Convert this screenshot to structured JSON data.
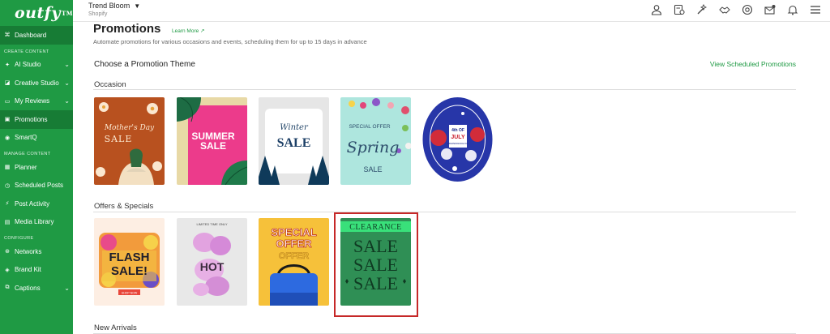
{
  "sidebar": {
    "logo": "outfy",
    "logo_tm": "TM",
    "items": [
      {
        "label": "Dashboard",
        "icon": "dashboard-icon"
      },
      {
        "section": "CREATE CONTENT"
      },
      {
        "label": "AI Studio",
        "icon": "sparkle-icon"
      },
      {
        "label": "Creative Studio",
        "icon": "palette-icon"
      },
      {
        "label": "My Reviews",
        "icon": "review-icon"
      },
      {
        "label": "Promotions",
        "icon": "promotion-icon"
      },
      {
        "label": "SmartQ",
        "icon": "queue-icon"
      },
      {
        "section": "MANAGE CONTENT"
      },
      {
        "label": "Planner",
        "icon": "calendar-icon"
      },
      {
        "label": "Scheduled Posts",
        "icon": "clock-icon"
      },
      {
        "label": "Post Activity",
        "icon": "activity-icon"
      },
      {
        "label": "Media Library",
        "icon": "image-icon"
      },
      {
        "section": "CONFIGURE"
      },
      {
        "label": "Networks",
        "icon": "network-icon"
      },
      {
        "label": "Brand Kit",
        "icon": "brand-icon"
      },
      {
        "label": "Captions",
        "icon": "caption-icon"
      }
    ]
  },
  "topbar": {
    "store_name": "Trend Bloom",
    "store_sub": "Shopify",
    "icons": [
      "user-icon",
      "billing-icon",
      "tools-icon",
      "handshake-icon",
      "support-icon",
      "mail-icon",
      "notification-icon",
      "menu-icon"
    ]
  },
  "main": {
    "title": "Promotions",
    "learn_more": "Learn More ↗",
    "subtitle": "Automate promotions for various occasions and events, scheduling them for up to 15 days in advance",
    "choose_theme": "Choose a Promotion Theme",
    "view_scheduled": "View Scheduled Promotions",
    "categories": [
      {
        "name": "Occasion"
      },
      {
        "name": "Offers & Specials"
      },
      {
        "name": "New Arrivals"
      }
    ],
    "tiles": {
      "mothers_day": {
        "line1": "Mother's Day",
        "line2": "SALE"
      },
      "summer": {
        "line1": "SUMMER",
        "line2": "SALE"
      },
      "winter": {
        "line1": "Winter",
        "line2": "SALE"
      },
      "spring": {
        "line1": "SPECIAL OFFER",
        "line2": "Spring",
        "line3": "SALE"
      },
      "july": {
        "line1": "4th OF",
        "line2": "JULY",
        "line3": "INDEPENDENCE DAY"
      },
      "flash": {
        "line1": "FLASH",
        "line2": "SALE!",
        "line3": "SHOP NOW"
      },
      "hot": {
        "line1": "LIMITED TIME ONLY",
        "line2": "HOT"
      },
      "special": {
        "line1": "SPECIAL",
        "line2": "OFFER",
        "line3": "OFFER"
      },
      "clearance": {
        "line1": "CLEARANCE",
        "line2": "SALE",
        "line3": "SALE",
        "line4": "SALE"
      }
    }
  }
}
